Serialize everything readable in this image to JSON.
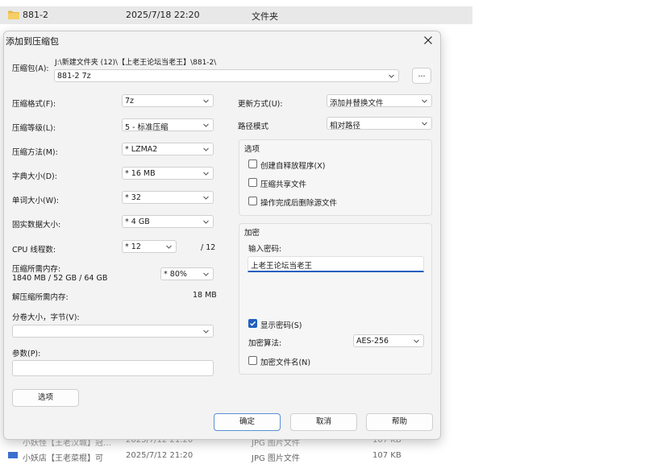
{
  "explorer": {
    "top_row": {
      "name": "881-2",
      "date": "2025/7/18 22:20",
      "type": "文件夹"
    },
    "bottom_rows": [
      {
        "name": "小妖怪【王老汉城】冠…",
        "date": "2025/7/12 21:20",
        "type": "JPG 图片文件",
        "size": "107 KB"
      },
      {
        "name": "小妖店【王老菜棍】可",
        "date": "2025/7/12 21:20",
        "type": "JPG 图片文件",
        "size": "107 KB"
      }
    ]
  },
  "dialog": {
    "title": "添加到压缩包",
    "archive": {
      "label": "压缩包(A):",
      "path": "J:\\新建文件夹 (12)\\【上老王论坛当老王】\\881-2\\",
      "name_value": "881-2 7z",
      "browse_label": "..."
    },
    "left": {
      "format": {
        "label": "压缩格式(F):",
        "value": "7z"
      },
      "level": {
        "label": "压缩等级(L):",
        "value": "5 - 标准压缩"
      },
      "method": {
        "label": "压缩方法(M):",
        "value": "* LZMA2"
      },
      "dict": {
        "label": "字典大小(D):",
        "value": "* 16 MB"
      },
      "word": {
        "label": "单词大小(W):",
        "value": "* 32"
      },
      "solid": {
        "label": "固实数据大小:",
        "value": "* 4 GB"
      },
      "threads": {
        "label": "CPU 线程数:",
        "value": "* 12",
        "max": "/ 12"
      },
      "memory": {
        "label": "压缩所需内存:",
        "detail": "1840 MB / 52 GB / 64 GB",
        "value": "* 80%"
      },
      "decompress_memory": {
        "label": "解压缩所需内存:",
        "value": "18 MB"
      },
      "split": {
        "label": "分卷大小，字节(V):",
        "value": ""
      },
      "params": {
        "label": "参数(P):",
        "value": ""
      },
      "options_button": "选项"
    },
    "right": {
      "update_mode": {
        "label": "更新方式(U):",
        "value": "添加并替换文件"
      },
      "path_mode": {
        "label": "路径模式",
        "value": "相对路径"
      },
      "options_group": {
        "title": "选项",
        "items": [
          {
            "label": "创建自释放程序(X)",
            "checked": false
          },
          {
            "label": "压缩共享文件",
            "checked": false
          },
          {
            "label": "操作完成后删除源文件",
            "checked": false
          }
        ]
      },
      "encryption": {
        "title": "加密",
        "password_label": "输入密码:",
        "password_value": "上老王论坛当老王",
        "show_password_label": "显示密码(S)",
        "show_password_checked": true,
        "method_label": "加密算法:",
        "method_value": "AES-256",
        "encrypt_names_label": "加密文件名(N)",
        "encrypt_names_checked": false
      }
    },
    "buttons": {
      "ok": "确定",
      "cancel": "取消",
      "help": "帮助"
    }
  },
  "colors": {
    "accent": "#1f5fbf",
    "folder": "#e8b94a",
    "dialog_bg": "#f3f3f3"
  }
}
